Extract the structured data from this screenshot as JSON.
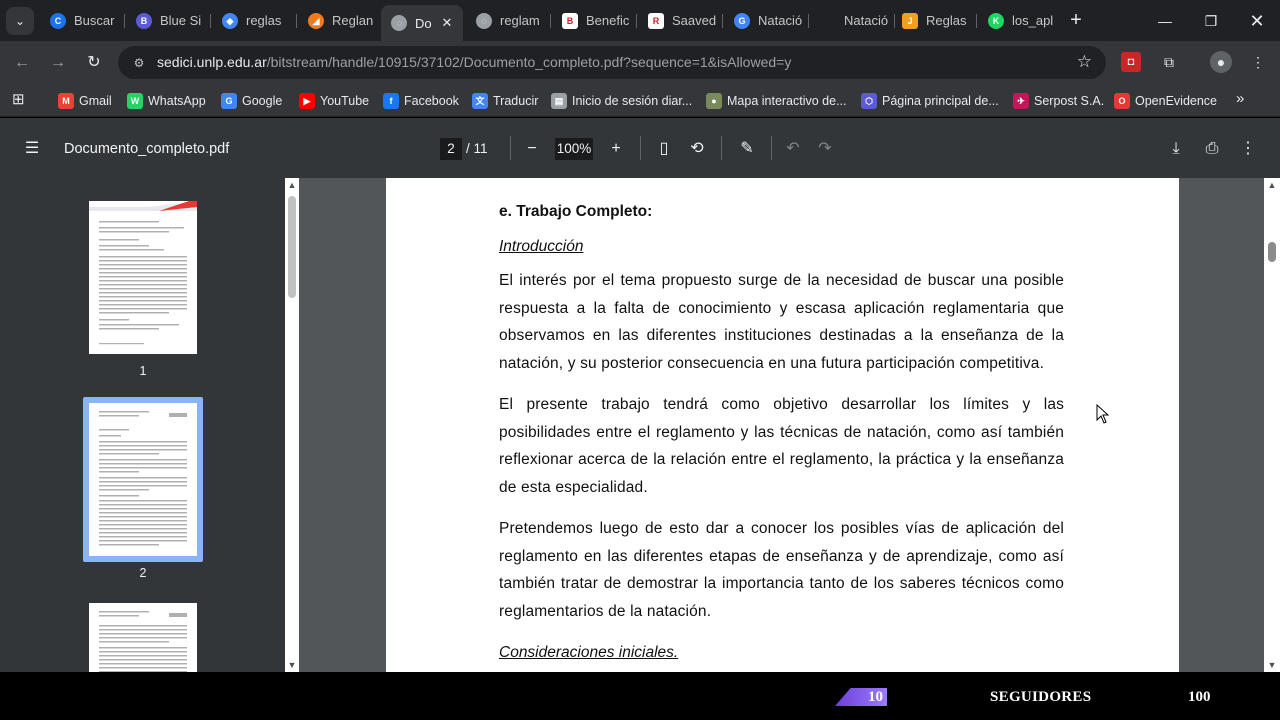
{
  "browser": {
    "tabs": [
      {
        "title": "Buscar",
        "fav_color": "#1a73e8",
        "fav_glyph": "C"
      },
      {
        "title": "Blue Si",
        "fav_color": "#5b5bd6",
        "fav_glyph": "B"
      },
      {
        "title": "reglas",
        "fav_color": "#4285f4",
        "fav_glyph": "◆"
      },
      {
        "title": "Reglan",
        "fav_color": "#f07b1f",
        "fav_glyph": "◢"
      },
      {
        "title": "Do",
        "fav_color": "#9aa0a6",
        "fav_glyph": "◌",
        "active": true
      },
      {
        "title": "reglam",
        "fav_color": "#9aa0a6",
        "fav_glyph": "◌"
      },
      {
        "title": "Benefic",
        "fav_color": "#ffffff",
        "fav_glyph": "B"
      },
      {
        "title": "Saaved",
        "fav_color": "#ffffff",
        "fav_glyph": "R"
      },
      {
        "title": "Natació",
        "fav_color": "#4285f4",
        "fav_glyph": "G"
      },
      {
        "title": "Natació",
        "fav_color": "#202124",
        "fav_glyph": ""
      },
      {
        "title": "Reglas",
        "fav_color": "#f0a020",
        "fav_glyph": "J"
      },
      {
        "title": "los_apl",
        "fav_color": "#1ed760",
        "fav_glyph": "K"
      }
    ],
    "url_host": "sedici.unlp.edu.ar",
    "url_path": "/bitstream/handle/10915/37102/Documento_completo.pdf?sequence=1&isAllowed=y",
    "bookmarks": [
      {
        "label": "Gmail",
        "color": "#ea4335",
        "glyph": "M"
      },
      {
        "label": "WhatsApp",
        "color": "#25d366",
        "glyph": "W"
      },
      {
        "label": "Google",
        "color": "#4285f4",
        "glyph": "G"
      },
      {
        "label": "YouTube",
        "color": "#ff0000",
        "glyph": "▶"
      },
      {
        "label": "Facebook",
        "color": "#1877f2",
        "glyph": "f"
      },
      {
        "label": "Traducir",
        "color": "#4285f4",
        "glyph": "文"
      },
      {
        "label": "Inicio de sesión diar...",
        "color": "#9aa0a6",
        "glyph": "▤"
      },
      {
        "label": "Mapa interactivo de...",
        "color": "#7a8a5a",
        "glyph": "●"
      },
      {
        "label": "Página principal de...",
        "color": "#5b5bd6",
        "glyph": "⬡"
      },
      {
        "label": "Serpost S.A.",
        "color": "#c2185b",
        "glyph": "✈"
      },
      {
        "label": "OpenEvidence",
        "color": "#e53935",
        "glyph": "O"
      }
    ]
  },
  "pdf": {
    "filename": "Documento_completo.pdf",
    "current_page": "2",
    "total_pages": "/ 11",
    "zoom": "100%",
    "thumb_labels": [
      "1",
      "2"
    ],
    "content": {
      "section_title": "e. Trabajo Completo:",
      "intro_heading": "Introducción",
      "paragraph_1": "El interés por el tema propuesto surge de la necesidad de buscar una posible respuesta a la falta de conocimiento y escasa aplicación reglamentaria que observamos en las diferentes instituciones destinadas a la enseñanza de la natación, y su posterior consecuencia en una futura participación competitiva.",
      "paragraph_2": "El presente trabajo tendrá como objetivo desarrollar los límites y las posibilidades entre el reglamento y las técnicas de natación, como así también reflexionar acerca de la relación entre el reglamento, la práctica y la enseñanza de esta especialidad.",
      "paragraph_3": "Pretendemos luego de esto dar a conocer los posibles vías de aplicación del reglamento en las diferentes etapas de enseñanza y de aprendizaje, como así también tratar de demostrar la importancia tanto de los saberes técnicos como reglamentarios de la natación.",
      "next_heading": "Consideraciones iniciales."
    }
  },
  "overlay": {
    "left_number": "10",
    "label": "SEGUIDORES",
    "right_number": "100"
  }
}
